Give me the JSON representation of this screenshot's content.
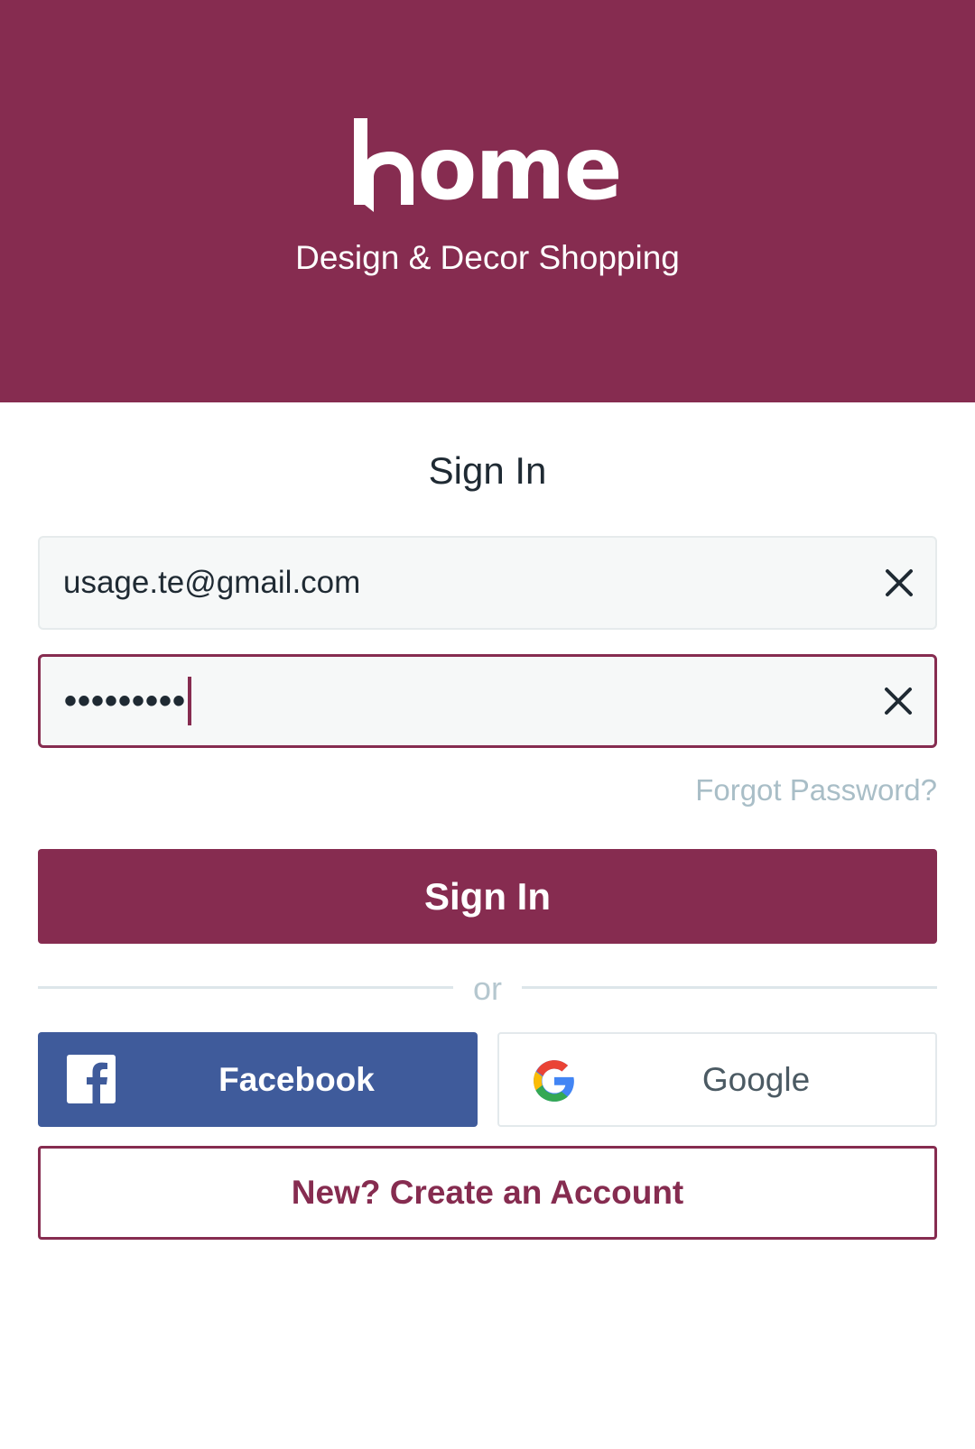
{
  "header": {
    "logo_text": "ome",
    "logo_full": "home",
    "tagline": "Design & Decor Shopping",
    "background_color": "#862c50"
  },
  "signin": {
    "title": "Sign In",
    "email_value": "usage.te@gmail.com",
    "password_masked": "•••••••••",
    "forgot_label": "Forgot Password?",
    "submit_label": "Sign In",
    "divider_label": "or"
  },
  "social": {
    "facebook_label": "Facebook",
    "facebook_color": "#3f5b9b",
    "google_label": "Google"
  },
  "create_account_label": "New? Create an Account",
  "icons": {
    "clear": "close-icon",
    "facebook": "facebook-icon",
    "google": "google-icon"
  }
}
